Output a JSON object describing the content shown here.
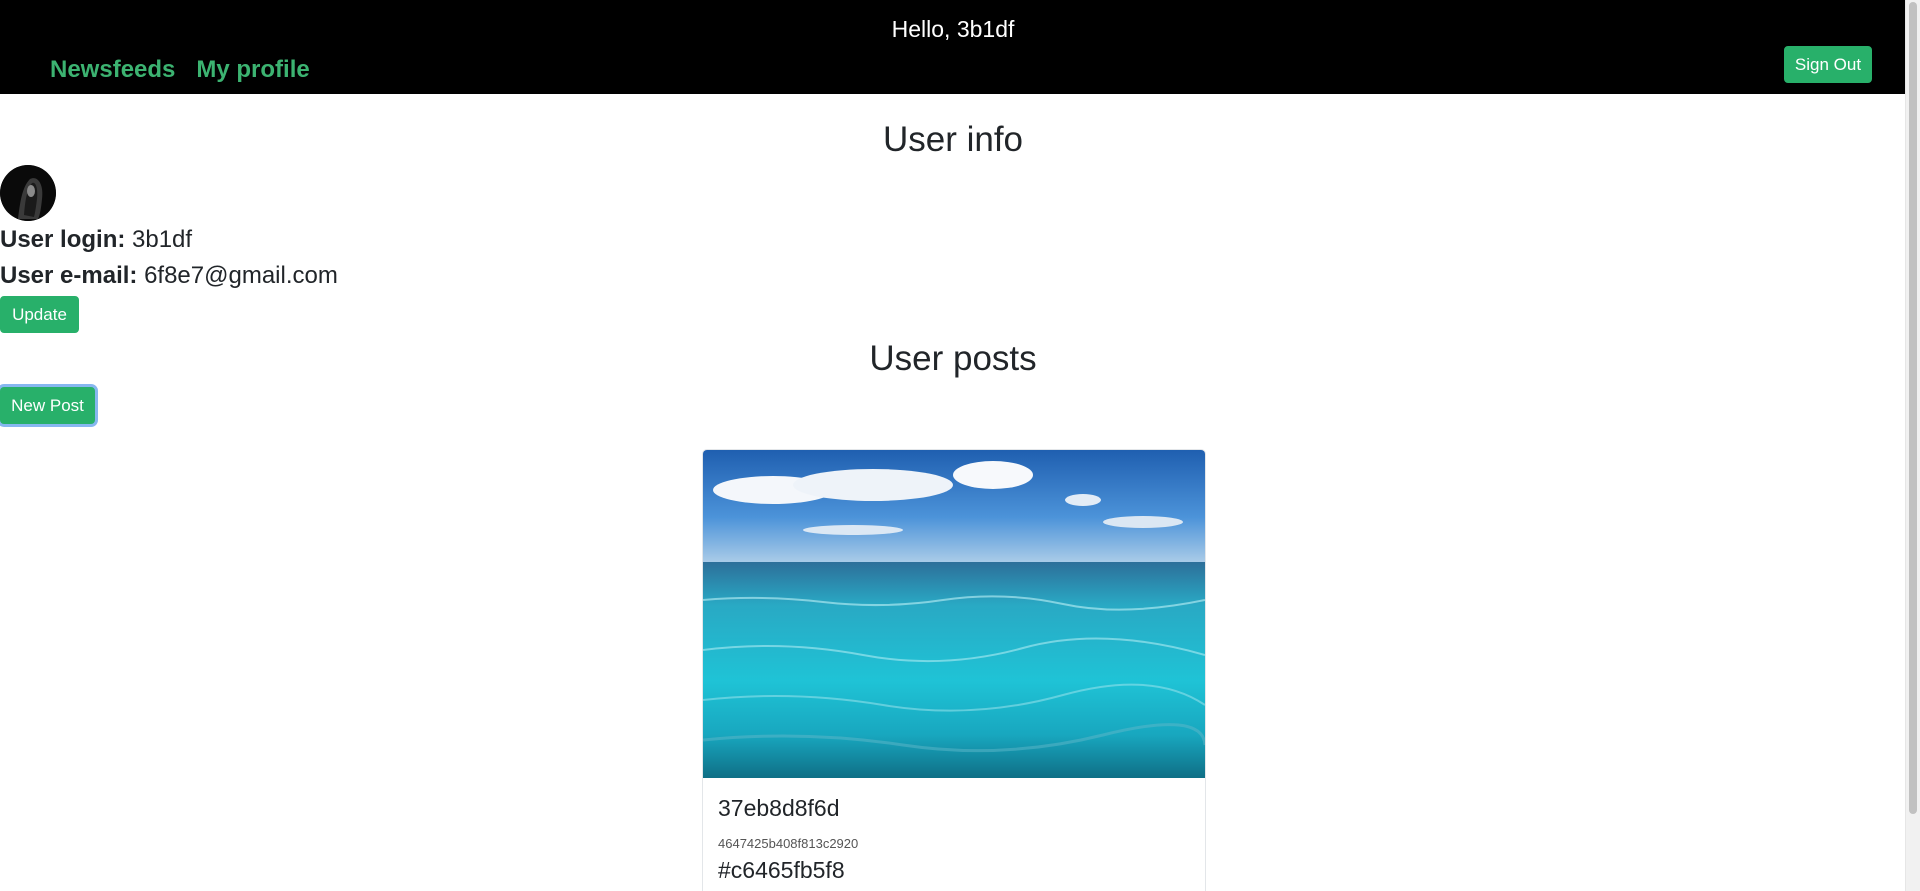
{
  "header": {
    "greeting": "Hello, 3b1df",
    "nav": [
      {
        "label": "Newsfeeds"
      },
      {
        "label": "My profile"
      }
    ],
    "sign_out_label": "Sign Out"
  },
  "user_info": {
    "title": "User info",
    "login_label": "User login:",
    "login_value": "3b1df",
    "email_label": "User e-mail:",
    "email_value": "6f8e7@gmail.com",
    "update_label": "Update"
  },
  "user_posts": {
    "title": "User posts",
    "new_post_label": "New Post",
    "posts": [
      {
        "title": "37eb8d8f6d",
        "subtitle": "4647425b408f813c2920",
        "tag": "#c6465fb5f8"
      }
    ]
  },
  "colors": {
    "header_bg": "#000000",
    "accent": "#28b06a",
    "nav_link": "#3cb371"
  }
}
